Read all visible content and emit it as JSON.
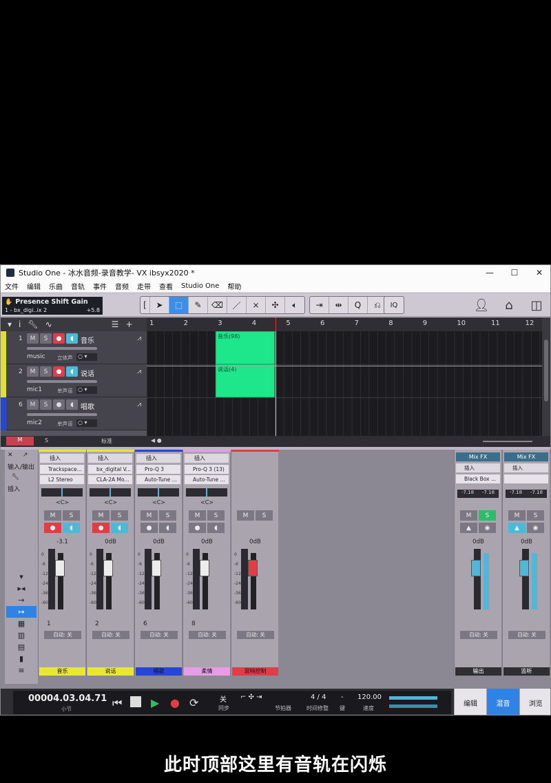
{
  "window": {
    "title": "Studio One - 冰水音频-录音教学- VX  ibsyx2020  *",
    "min": "—",
    "max": "☐",
    "close": "✕"
  },
  "menu": [
    "文件",
    "编辑",
    "乐曲",
    "音轨",
    "事件",
    "音频",
    "走带",
    "查看",
    "Studio One",
    "帮助"
  ],
  "event_info": {
    "title": "Presence Shift Gain",
    "track": "1 - bx_digi..ix 2",
    "value": "+5.8"
  },
  "ruler": {
    "ticks": [
      "1",
      "2",
      "3",
      "4",
      "5",
      "6",
      "7",
      "8",
      "9",
      "10",
      "11",
      "12"
    ]
  },
  "tracks": [
    {
      "num": "1",
      "name": "音乐",
      "input": "music",
      "mode": "立体声",
      "color": "#e0e030"
    },
    {
      "num": "2",
      "name": "说话",
      "input": "mic1",
      "mode": "单声道",
      "color": "#e0e030"
    },
    {
      "num": "6",
      "name": "唱歌",
      "input": "mic2",
      "mode": "单声道",
      "color": "#2546d8"
    }
  ],
  "clips": [
    {
      "label": "音乐(98)"
    },
    {
      "label": "说话(4)"
    }
  ],
  "track_buttons": {
    "m": "M",
    "s": "S"
  },
  "bottom": {
    "m_label": "M",
    "s_label": "S",
    "standard": "标准"
  },
  "console": {
    "sidebar": {
      "in_out": "输入/输出",
      "insert": "插入"
    },
    "channels": [
      {
        "ins": "插入",
        "slot1": "Trackspace...",
        "slot2": "L2 Stereo",
        "pan": "<C>",
        "vol": "-3.1",
        "num": "1",
        "auto": "自动: 关",
        "name": "音乐",
        "color": "#e8e834"
      },
      {
        "ins": "插入",
        "slot1": "bx_digital V...",
        "slot2": "CLA-2A Mo...",
        "pan": "<C>",
        "vol": "0dB",
        "num": "2",
        "auto": "自动: 关",
        "name": "说话",
        "color": "#e8e834"
      },
      {
        "ins": "插入",
        "slot1": "Pro-Q 3",
        "slot2": "Auto-Tune ...",
        "pan": "<C>",
        "vol": "0dB",
        "num": "6",
        "auto": "自动: 关",
        "name": "唱歌",
        "color": "#2546d8"
      },
      {
        "ins": "插入",
        "slot1": "Pro-Q 3 (13)",
        "slot2": "Auto-Tune ...",
        "pan": "<C>",
        "vol": "0dB",
        "num": "8",
        "auto": "自动: 关",
        "name": "柔情",
        "color": "#e79ce8"
      },
      {
        "ins": "",
        "slot1": "",
        "slot2": "",
        "pan": "",
        "vol": "0dB",
        "num": "",
        "auto": "自动: 关",
        "name": "混响控制",
        "color": "#e03e46"
      }
    ],
    "outputs": [
      {
        "fx": "Mix FX",
        "ins": "插入",
        "slot1": "Black Box ...",
        "l": "-7.18",
        "r": "-7.18",
        "vol": "0dB",
        "auto": "自动: 关",
        "name": "输出"
      },
      {
        "fx": "Mix FX",
        "ins": "插入",
        "slot1": "",
        "l": "-7.18",
        "r": "-7.18",
        "vol": "0dB",
        "auto": "自动: 关",
        "name": "监听"
      }
    ]
  },
  "transport": {
    "time": "00004.03.04.71",
    "unit": "小节",
    "off": "关",
    "sync": "同步",
    "metronome": "节拍器",
    "sig": "4 / 4",
    "sig_label": "时间修整",
    "key": "-",
    "key_label": "键",
    "tempo": "120.00",
    "tempo_label": "速度"
  },
  "view_tabs": [
    "编辑",
    "混音",
    "浏览"
  ],
  "caption": "此时顶部这里有音轨在闪烁"
}
